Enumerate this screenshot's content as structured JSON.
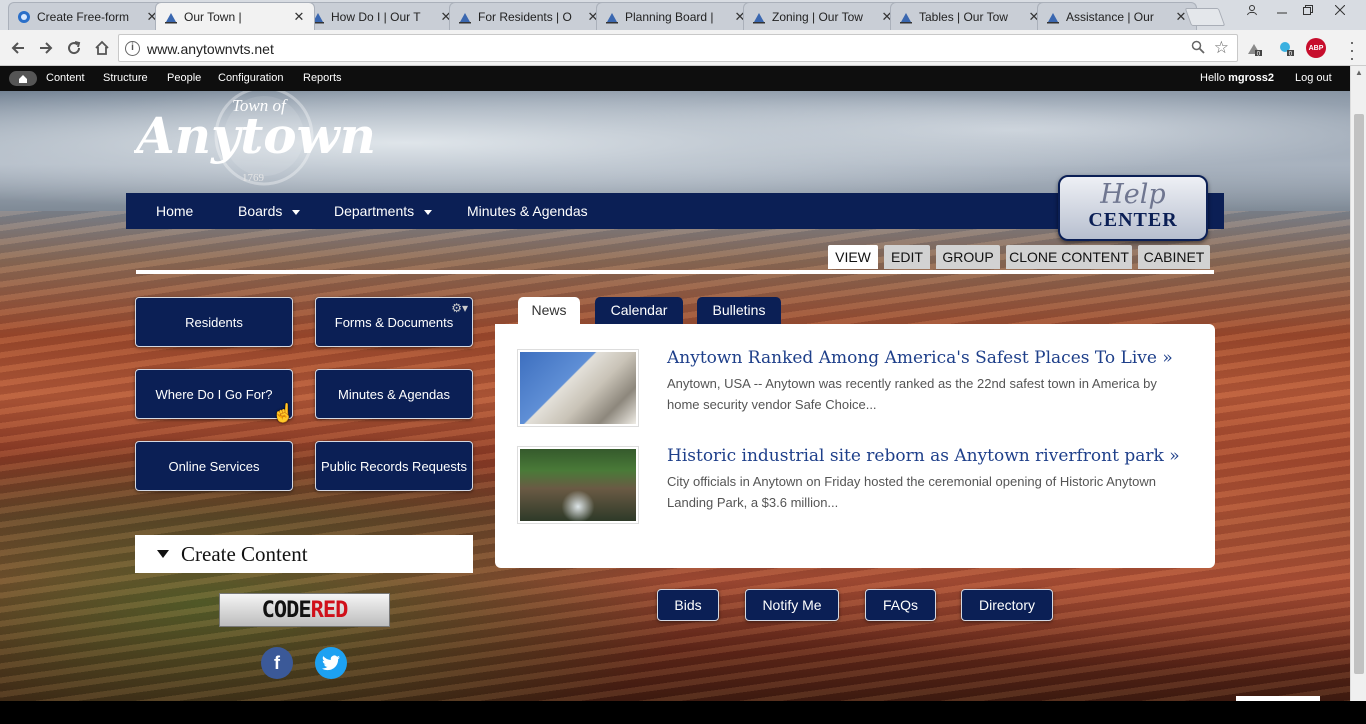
{
  "browser": {
    "tabs": [
      {
        "label": "Create Free-form",
        "icon": "edge-favicon"
      },
      {
        "label": "Our Town |",
        "icon": "site-favicon",
        "active": true
      },
      {
        "label": "How Do I | Our T",
        "icon": "site-favicon"
      },
      {
        "label": "For Residents | O",
        "icon": "site-favicon"
      },
      {
        "label": "Planning Board |",
        "icon": "site-favicon"
      },
      {
        "label": "Zoning | Our Tow",
        "icon": "site-favicon"
      },
      {
        "label": "Tables | Our Tow",
        "icon": "site-favicon"
      },
      {
        "label": "Assistance | Our",
        "icon": "site-favicon"
      }
    ],
    "close_glyph": "✕",
    "url": "www.anytownvts.net",
    "ext_badge": "0",
    "abp": "ABP"
  },
  "admin_bar": {
    "items": [
      "Content",
      "Structure",
      "People",
      "Configuration",
      "Reports"
    ],
    "hello_prefix": "Hello",
    "username": "mgross2",
    "logout": "Log out"
  },
  "site": {
    "logo_small": "Town of",
    "logo_main": "Anytown",
    "logo_year": "1769",
    "nav": [
      {
        "label": "Home"
      },
      {
        "label": "Boards"
      },
      {
        "label": "Departments"
      },
      {
        "label": "Minutes & Agendas"
      }
    ],
    "help_top": "Help",
    "help_bottom": "CENTER",
    "admin_tabs": [
      "VIEW",
      "EDIT",
      "GROUP",
      "CLONE CONTENT",
      "CABINET"
    ],
    "quick_links": [
      "Residents",
      "Forms & Documents",
      "Where Do I Go For?",
      "Minutes & Agendas",
      "Online Services",
      "Public Records Requests"
    ],
    "create_content": "Create Content",
    "codered_code": "CODE",
    "codered_red": "RED",
    "social": {
      "facebook": "f",
      "twitter": "t"
    },
    "news_tabs": [
      "News",
      "Calendar",
      "Bulletins"
    ],
    "news": [
      {
        "title": "Anytown Ranked Among America's Safest Places To Live »",
        "body": "Anytown, USA -- Anytown was recently ranked as the 22nd safest town in America by home security vendor Safe Choice..."
      },
      {
        "title": "Historic industrial site reborn as Anytown riverfront park »",
        "body": "City officials in Anytown on Friday hosted the ceremonial opening of Historic Anytown Landing Park, a $3.6 million..."
      }
    ],
    "bottom_links": [
      "Bids",
      "Notify Me",
      "FAQs",
      "Directory"
    ]
  },
  "colors": {
    "navy": "#0b1f55",
    "link_blue": "#1e3f8a",
    "admin_bar": "#0e0e0e"
  }
}
